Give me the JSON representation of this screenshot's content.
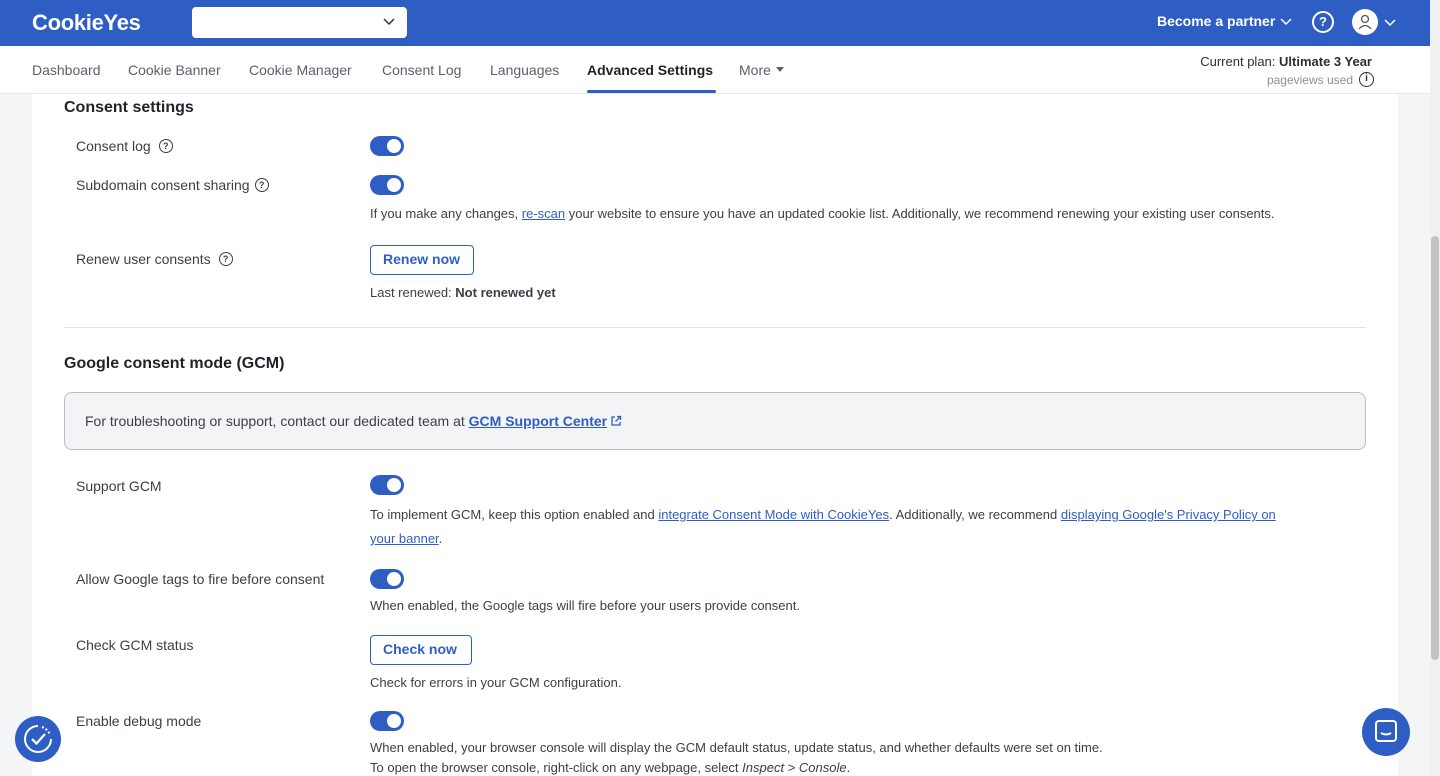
{
  "header": {
    "logo_text": "CookieYes",
    "site_selector_value": "",
    "partner_label": "Become a partner",
    "help_glyph": "?",
    "colors": {
      "primary": "#2e5ec4"
    }
  },
  "nav": {
    "items": [
      {
        "label": "Dashboard"
      },
      {
        "label": "Cookie Banner"
      },
      {
        "label": "Cookie Manager"
      },
      {
        "label": "Consent Log"
      },
      {
        "label": "Languages"
      },
      {
        "label": "Advanced Settings",
        "active": true
      },
      {
        "label": "More"
      }
    ],
    "plan_prefix": "Current plan:",
    "plan_name": "Ultimate 3 Year",
    "pageviews_label": "pageviews used",
    "info_glyph": "i"
  },
  "consent_settings": {
    "title": "Consent settings",
    "consent_log_label": "Consent log",
    "consent_log_enabled": true,
    "subdomain_label": "Subdomain consent sharing",
    "subdomain_enabled": true,
    "subdomain_desc_before": "If you make any changes, ",
    "subdomain_desc_link": "re-scan",
    "subdomain_desc_after": " your website to ensure you have an updated cookie list. Additionally, we recommend renewing your existing user consents.",
    "renew_label": "Renew user consents",
    "renew_button": "Renew now",
    "last_renewed_label": "Last renewed:",
    "last_renewed_value": "Not renewed yet"
  },
  "gcm": {
    "title": "Google consent mode (GCM)",
    "banner_text": "For troubleshooting or support, contact our dedicated team at ",
    "banner_link": "GCM Support Center",
    "support_label": "Support GCM",
    "support_enabled": true,
    "support_desc_before": "To implement GCM, keep this option enabled and ",
    "support_desc_link1": "integrate Consent Mode with CookieYes",
    "support_desc_middle": ". Additionally, we recommend ",
    "support_desc_link2a": "displaying Google's Privacy Policy on",
    "support_desc_link2b": "your banner",
    "support_desc_end": ".",
    "allow_tags_label": "Allow Google tags to fire before consent",
    "allow_tags_enabled": true,
    "allow_tags_desc": "When enabled, the Google tags will fire before your users provide consent.",
    "check_status_label": "Check GCM status",
    "check_button": "Check now",
    "check_desc": "Check for errors in your GCM configuration.",
    "debug_label": "Enable debug mode",
    "debug_enabled": true,
    "debug_desc1": "When enabled, your browser console will display the GCM default status, update status, and whether defaults were set on time.",
    "debug_desc2_before": "To open the browser console, right-click on any webpage, select ",
    "debug_desc2_em": "Inspect > Console",
    "debug_desc2_after": "."
  },
  "icons": {
    "consent_widget": "cookie-consent-check-icon",
    "chat_widget": "chat-bubble-icon",
    "external_link": "external-link-icon"
  }
}
